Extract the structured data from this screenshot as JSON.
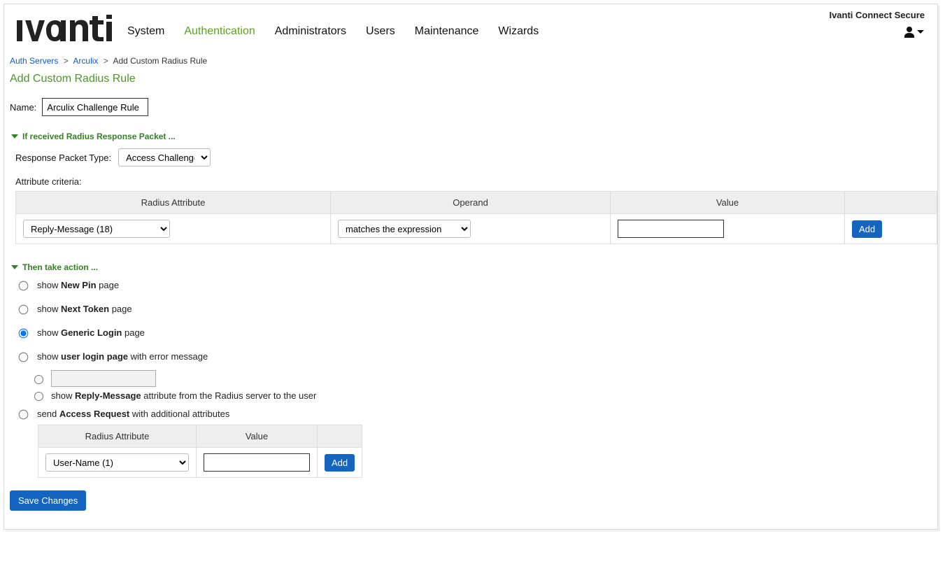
{
  "product_name": "Ivanti Connect Secure",
  "nav": {
    "items": [
      "System",
      "Authentication",
      "Administrators",
      "Users",
      "Maintenance",
      "Wizards"
    ],
    "active_index": 1
  },
  "breadcrumb": {
    "link1": "Auth Servers",
    "link2": "Arculix",
    "sep": ">",
    "current": "Add Custom Radius Rule"
  },
  "page_title": "Add Custom Radius Rule",
  "name_label": "Name:",
  "name_value": "Arculix Challenge Rule",
  "section_if": "If received Radius Response Packet ...",
  "resp_label": "Response Packet Type:",
  "resp_value": "Access Challenge",
  "attr_criteria_label": "Attribute criteria:",
  "crit_headers": {
    "attr": "Radius Attribute",
    "op": "Operand",
    "val": "Value"
  },
  "crit_row": {
    "attr": "Reply-Message (18)",
    "op": "matches the expression",
    "val": "",
    "add": "Add"
  },
  "section_then": "Then take action ...",
  "actions": {
    "a1_pre": "show ",
    "a1_b": "New Pin",
    "a1_post": " page",
    "a2_pre": "show ",
    "a2_b": "Next Token",
    "a2_post": " page",
    "a3_pre": "show ",
    "a3_b": "Generic Login",
    "a3_post": " page",
    "a4_pre": "show ",
    "a4_b": "user login page",
    "a4_post": " with error message",
    "a4_sub2_pre": "show ",
    "a4_sub2_b": "Reply-Message",
    "a4_sub2_post": " attribute from the Radius server to the user",
    "a5_pre": "send ",
    "a5_b": "Access Request",
    "a5_post": " with additional attributes"
  },
  "inner_headers": {
    "attr": "Radius Attribute",
    "val": "Value"
  },
  "inner_row": {
    "attr": "User-Name (1)",
    "val": "",
    "add": "Add"
  },
  "save_label": "Save Changes"
}
